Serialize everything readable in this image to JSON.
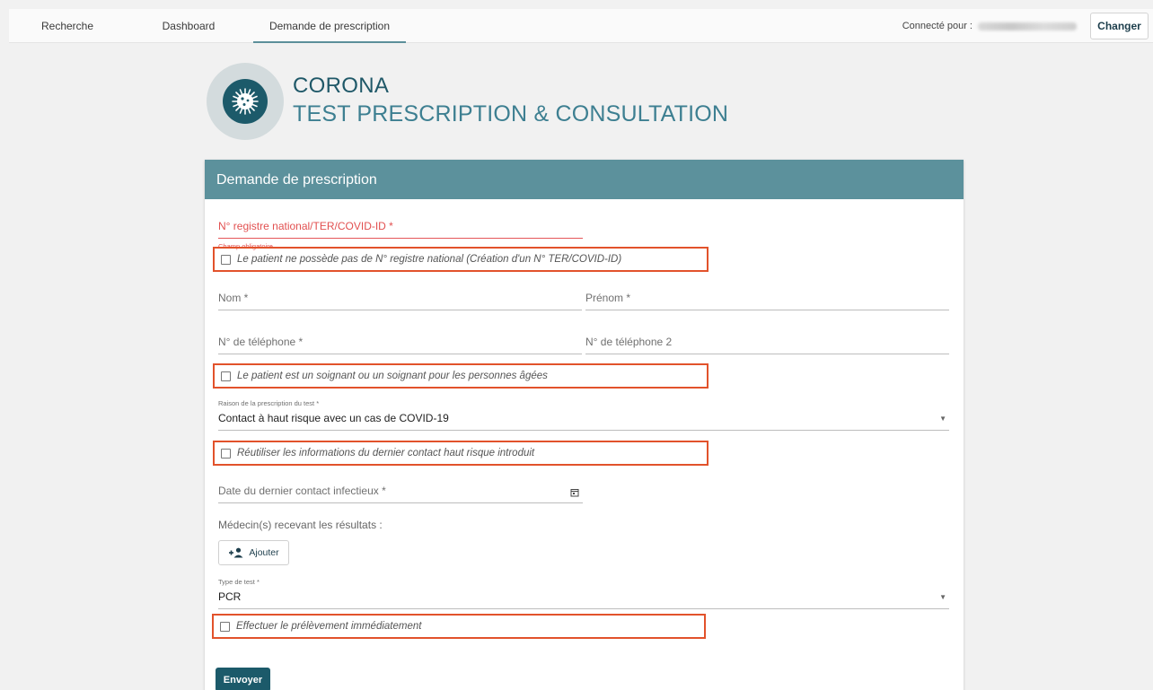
{
  "nav": {
    "tabs": [
      {
        "label": "Recherche"
      },
      {
        "label": "Dashboard"
      },
      {
        "label": "Demande de prescription"
      }
    ],
    "connected_label": "Connecté pour :",
    "change_button": "Changer"
  },
  "header": {
    "title": "CORONA",
    "subtitle": "TEST PRESCRIPTION & CONSULTATION"
  },
  "form": {
    "title": "Demande de prescription",
    "national_id": {
      "placeholder": "N° registre national/TER/COVID-ID *",
      "error": "Champ obligatoire"
    },
    "no_national_id_checkbox": "Le patient ne possède pas de N° registre national (Création d'un N° TER/COVID-ID)",
    "last_name": "Nom *",
    "first_name": "Prénom *",
    "phone": "N° de téléphone *",
    "phone2": "N° de téléphone 2",
    "caregiver_checkbox": "Le patient est un soignant ou un soignant pour les personnes âgées",
    "reason": {
      "label": "Raison de la prescription du test *",
      "value": "Contact à haut risque avec un cas de COVID-19"
    },
    "reuse_checkbox": "Réutiliser les informations du dernier contact haut risque introduit",
    "last_contact_date": "Date du dernier contact infectieux *",
    "doctors_label": "Médecin(s) recevant les résultats :",
    "add_button": "Ajouter",
    "test_type": {
      "label": "Type de test *",
      "value": "PCR"
    },
    "immediate_checkbox": "Effectuer le prélèvement immédiatement",
    "submit_button": "Envoyer"
  },
  "colors": {
    "accent": "#5c919c",
    "primary_dark": "#1c5a6a",
    "error": "#e25050",
    "highlight": "#e2522b"
  }
}
